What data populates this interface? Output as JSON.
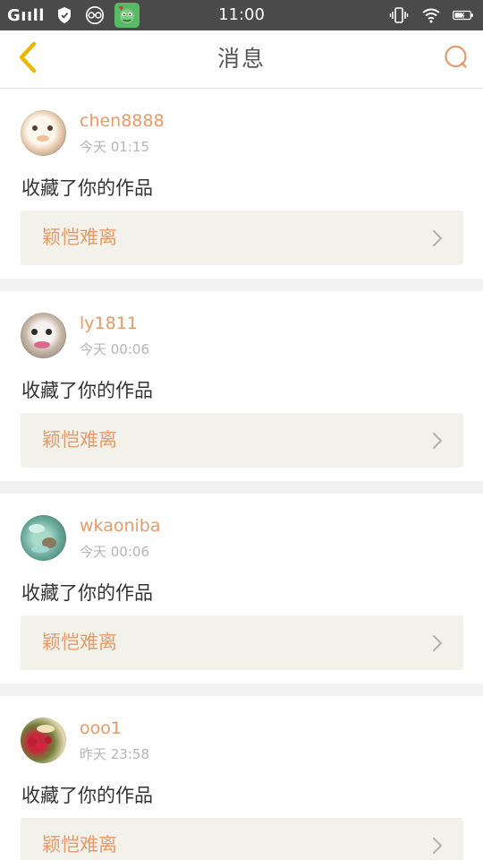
{
  "status_bar": {
    "carrier": "Gııll",
    "time": "11:00"
  },
  "header": {
    "title": "消息"
  },
  "colors": {
    "accent": "#e59a6a",
    "back_arrow": "#e8b800",
    "status_bar_bg": "#4a4a4a",
    "card_link_bg": "#f3f2ea",
    "divider_bg": "#f2f2f2"
  },
  "icons": {
    "back": "chevron-left-icon",
    "search": "search-icon",
    "link_arrow": "chevron-right-icon",
    "status_shield": "shield-icon",
    "status_glasses": "glasses-icon",
    "status_vibrate": "vibrate-icon",
    "status_wifi": "wifi-icon",
    "status_battery": "battery-icon"
  },
  "messages": [
    {
      "username": "chen8888",
      "time": "今天 01:15",
      "action": "收藏了你的作品",
      "work_title": "颖恺难离"
    },
    {
      "username": "ly1811",
      "time": "今天 00:06",
      "action": "收藏了你的作品",
      "work_title": "颖恺难离"
    },
    {
      "username": "wkaoniba",
      "time": "今天 00:06",
      "action": "收藏了你的作品",
      "work_title": "颖恺难离"
    },
    {
      "username": "ooo1",
      "time": "昨天 23:58",
      "action": "收藏了你的作品",
      "work_title": "颖恺难离"
    }
  ]
}
